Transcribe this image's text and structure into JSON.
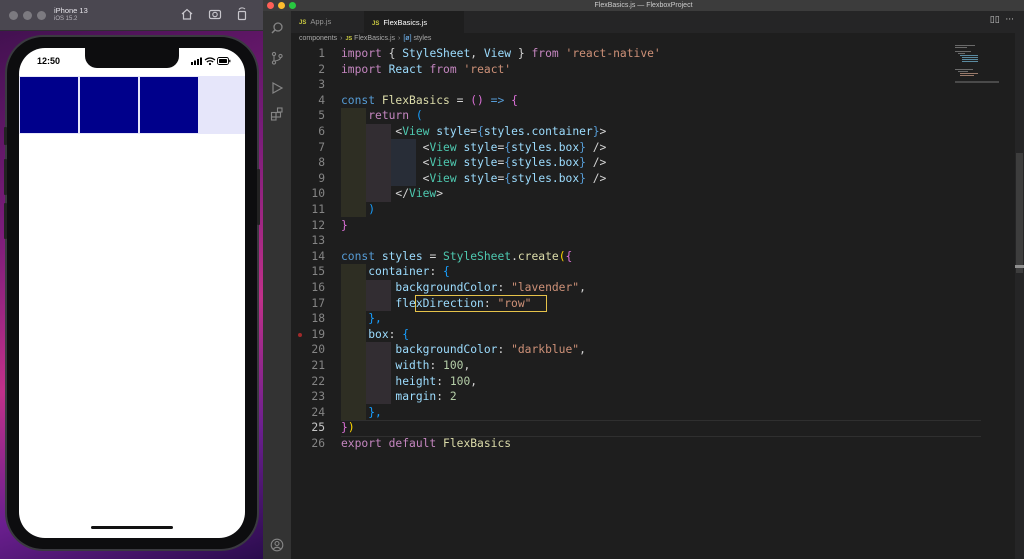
{
  "simulator": {
    "device_name": "iPhone 13",
    "os_version": "iOS 15.2",
    "toolbar_icons": [
      "home-icon",
      "screenshot-icon",
      "rotate-icon"
    ],
    "status_time": "12:50",
    "status_icons": [
      "signal-icon",
      "wifi-icon",
      "battery-icon"
    ],
    "container_color": "#e6e6fa",
    "box_color": "#00008b"
  },
  "vscode": {
    "window_title": "FlexBasics.js — FlexboxProject",
    "tabs": [
      {
        "icon": "JS",
        "label": "App.js"
      },
      {
        "icon": "JS",
        "label": "FlexBasics.js"
      }
    ],
    "breadcrumb": {
      "folder": "components",
      "file_icon": "JS",
      "file": "FlexBasics.js",
      "symbol_icon": "[ø]",
      "symbol": "styles"
    },
    "activity_icons": [
      "explorer-icon",
      "search-icon",
      "source-control-icon",
      "run-debug-icon",
      "extensions-icon",
      "account-icon"
    ],
    "code_lines": [
      {
        "n": "1"
      },
      {
        "n": "2"
      },
      {
        "n": "3"
      },
      {
        "n": "4"
      },
      {
        "n": "5"
      },
      {
        "n": "6"
      },
      {
        "n": "7"
      },
      {
        "n": "8"
      },
      {
        "n": "9"
      },
      {
        "n": "10"
      },
      {
        "n": "11"
      },
      {
        "n": "12"
      },
      {
        "n": "13"
      },
      {
        "n": "14"
      },
      {
        "n": "15"
      },
      {
        "n": "16"
      },
      {
        "n": "17"
      },
      {
        "n": "18"
      },
      {
        "n": "19"
      },
      {
        "n": "20"
      },
      {
        "n": "21"
      },
      {
        "n": "22"
      },
      {
        "n": "23"
      },
      {
        "n": "24"
      },
      {
        "n": "25"
      },
      {
        "n": "26"
      }
    ],
    "code": {
      "l1": {
        "import": "import",
        "ob": "{ ",
        "a": "StyleSheet",
        "c": ", ",
        "b": "View",
        "cb": " } ",
        "from": "from",
        "s": "'react-native'"
      },
      "l2": {
        "import": "import",
        "a": "React",
        "from": "from",
        "s": "'react'"
      },
      "l4": {
        "const": "const",
        "name": "FlexBasics",
        "eq": " = ",
        "p": "()",
        "arrow": " => ",
        "ob": "{"
      },
      "l5": {
        "ret": "return",
        "p": " ("
      },
      "l6": {
        "lt": "<",
        "tag": "View",
        "attr": "style",
        "eq": "=",
        "ob": "{",
        "expr": "styles.container",
        "cb": "}",
        "gt": ">"
      },
      "l7": {
        "lt": "<",
        "tag": "View",
        "attr": "style",
        "eq": "=",
        "ob": "{",
        "expr": "styles.box",
        "cb": "}",
        "gt": " />"
      },
      "l8": {
        "lt": "<",
        "tag": "View",
        "attr": "style",
        "eq": "=",
        "ob": "{",
        "expr": "styles.box",
        "cb": "}",
        "gt": " />"
      },
      "l9": {
        "lt": "<",
        "tag": "View",
        "attr": "style",
        "eq": "=",
        "ob": "{",
        "expr": "styles.box",
        "cb": "}",
        "gt": " />"
      },
      "l10": {
        "lt": "</",
        "tag": "View",
        "gt": ">"
      },
      "l11": {
        "p": ")"
      },
      "l12": {
        "cb": "}"
      },
      "l14": {
        "const": "const",
        "name": "styles",
        "eq": " = ",
        "cls": "StyleSheet",
        "dot": ".",
        "fn": "create",
        "op": "(",
        "ob": "{"
      },
      "l15": {
        "key": "container",
        "col": ": ",
        "ob": "{"
      },
      "l16": {
        "key": "backgroundColor",
        "col": ": ",
        "val": "\"lavender\"",
        "comma": ","
      },
      "l17": {
        "key": "flexDirection",
        "col": ": ",
        "val": "\"row\""
      },
      "l18": {
        "cb": "},"
      },
      "l19": {
        "key": "box",
        "col": ": ",
        "ob": "{"
      },
      "l20": {
        "key": "backgroundColor",
        "col": ": ",
        "val": "\"darkblue\"",
        "comma": ","
      },
      "l21": {
        "key": "width",
        "col": ": ",
        "val": "100",
        "comma": ","
      },
      "l22": {
        "key": "height",
        "col": ": ",
        "val": "100",
        "comma": ","
      },
      "l23": {
        "key": "margin",
        "col": ": ",
        "val": "2"
      },
      "l24": {
        "cb": "},"
      },
      "l25": {
        "cb": "}",
        "cp": ")"
      },
      "l26": {
        "exp": "export",
        "def": "default",
        "name": "FlexBasics"
      }
    }
  }
}
